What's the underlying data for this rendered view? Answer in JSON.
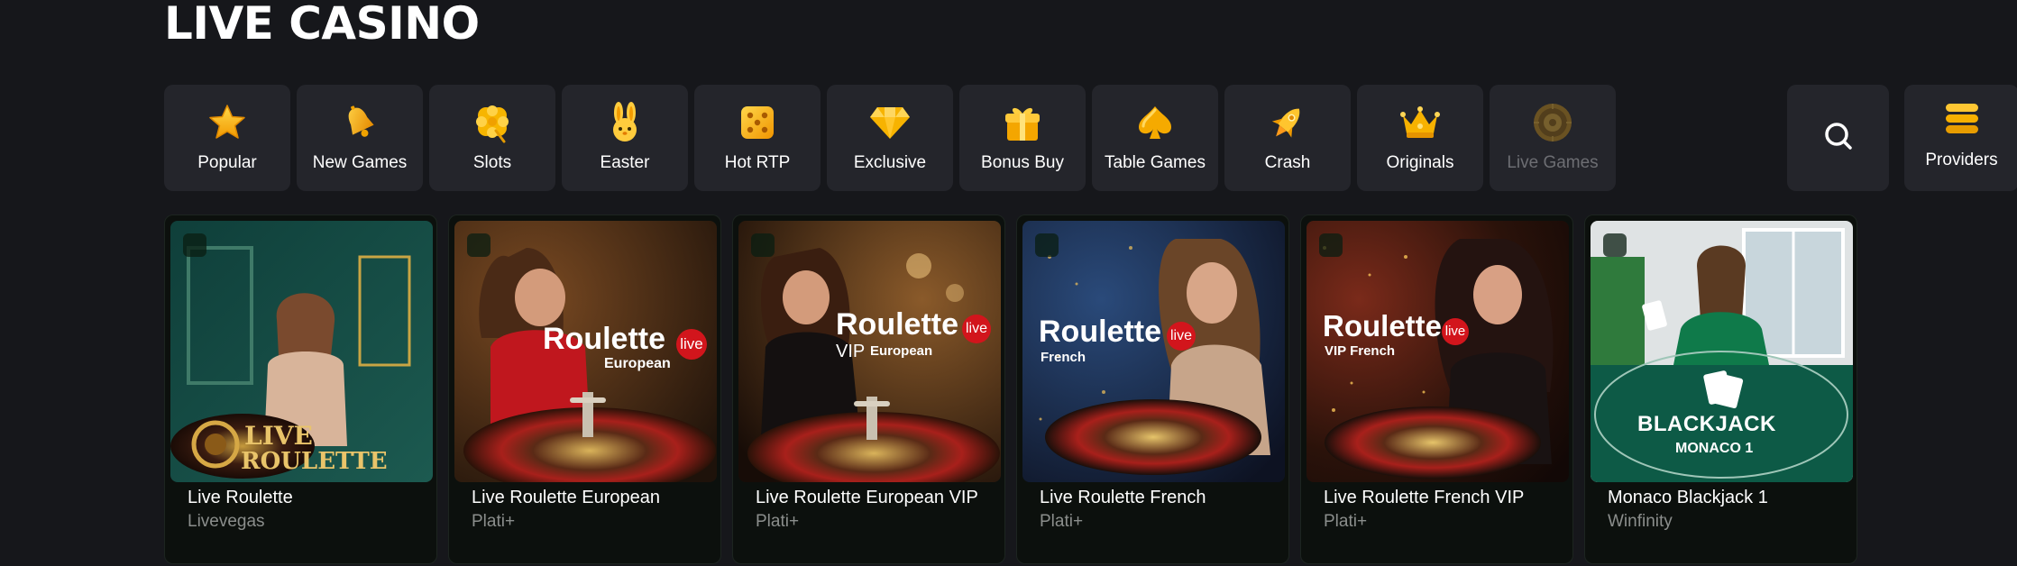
{
  "section": {
    "title": "LIVE CASINO"
  },
  "categories": [
    {
      "label": "Popular",
      "icon": "star-icon"
    },
    {
      "label": "New Games",
      "icon": "bell-icon"
    },
    {
      "label": "Slots",
      "icon": "clover-icon"
    },
    {
      "label": "Easter",
      "icon": "bunny-icon"
    },
    {
      "label": "Hot RTP",
      "icon": "dice-icon"
    },
    {
      "label": "Exclusive",
      "icon": "diamond-icon"
    },
    {
      "label": "Bonus Buy",
      "icon": "gift-icon"
    },
    {
      "label": "Table Games",
      "icon": "spade-icon"
    },
    {
      "label": "Crash",
      "icon": "rocket-icon"
    },
    {
      "label": "Originals",
      "icon": "crown-icon"
    },
    {
      "label": "Live Games",
      "icon": "roulette-wheel-icon"
    }
  ],
  "search": {
    "icon": "search-icon"
  },
  "providers": {
    "label": "Providers",
    "icon": "stack-icon"
  },
  "games": [
    {
      "name": "Live Roulette",
      "provider": "Livevegas",
      "art_title": "LIVE",
      "art_sub": "ROULETTE"
    },
    {
      "name": "Live Roulette European",
      "provider": "Plati+",
      "art_title": "Roulette",
      "art_badge": "live",
      "art_sub": "European"
    },
    {
      "name": "Live Roulette European VIP",
      "provider": "Plati+",
      "art_title": "Roulette",
      "art_badge": "live",
      "art_pre": "VIP",
      "art_sub": "European"
    },
    {
      "name": "Live Roulette French",
      "provider": "Plati+",
      "art_title": "Roulette",
      "art_badge": "live",
      "art_sub": "French"
    },
    {
      "name": "Live Roulette French VIP",
      "provider": "Plati+",
      "art_title": "Roulette",
      "art_badge": "live",
      "art_sub": "VIP French"
    },
    {
      "name": "Monaco Blackjack 1",
      "provider": "Winfinity",
      "art_title": "BLACKJACK",
      "art_sub": "MONACO 1"
    }
  ],
  "colors": {
    "accent_gold": "#f5b400",
    "badge_red": "#d2151c",
    "card_bg": "#0c100d",
    "tile_bg": "#24252b"
  }
}
